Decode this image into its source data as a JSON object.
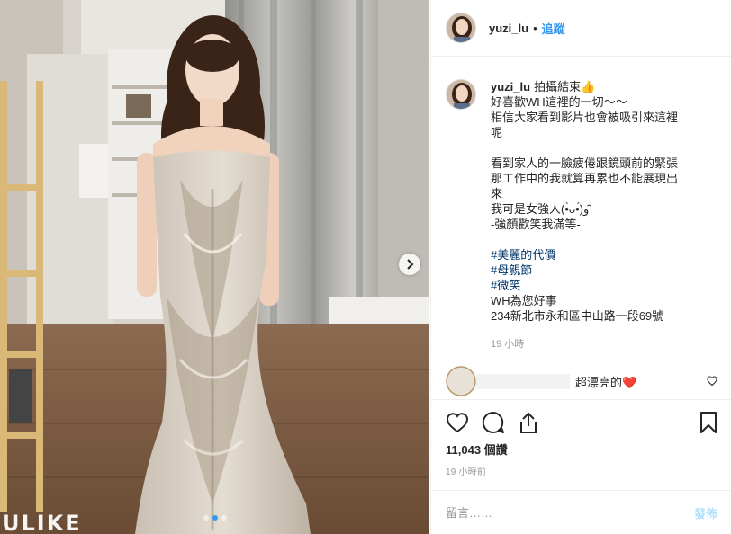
{
  "post": {
    "username": "yuzi_lu",
    "separator": "•",
    "follow_label": "追蹤",
    "caption_lines": [
      "拍攝結束👍",
      "好喜歡WH這裡的一切～～",
      "相信大家看到影片也會被吸引來這裡",
      "呢",
      "",
      "看到家人的一臉疲倦跟鏡頭前的緊張",
      "那工作中的我就算再累也不能展現出",
      "來",
      "我可是女強人(•̀ᴗ•́)و ̑̑",
      "-強顏歡笑我滿等-",
      ""
    ],
    "hashtags": [
      "#美麗的代價",
      "#母親節",
      "#微笑"
    ],
    "caption_tail": [
      "WH為您好事",
      "234新北市永和區中山路一段69號"
    ],
    "caption_time": "19 小時",
    "comment": {
      "text": "超漂亮的❤️"
    },
    "views": "11,043 個讚",
    "post_time": "19 小時前",
    "comment_placeholder": "留言……",
    "post_label": "發佈",
    "watermark": "ULIKE"
  },
  "icons": {
    "next": "chevron-right-icon",
    "like": "heart-outline-icon",
    "comment": "speech-bubble-icon",
    "share": "share-arrow-icon",
    "save": "bookmark-icon",
    "comment_like": "small-heart-icon"
  },
  "colors": {
    "accent": "#3897f0",
    "hashtag": "#003569",
    "muted": "#999999",
    "post_disabled": "#b2dffc"
  },
  "carousel": {
    "slides": 3,
    "active": 1
  }
}
